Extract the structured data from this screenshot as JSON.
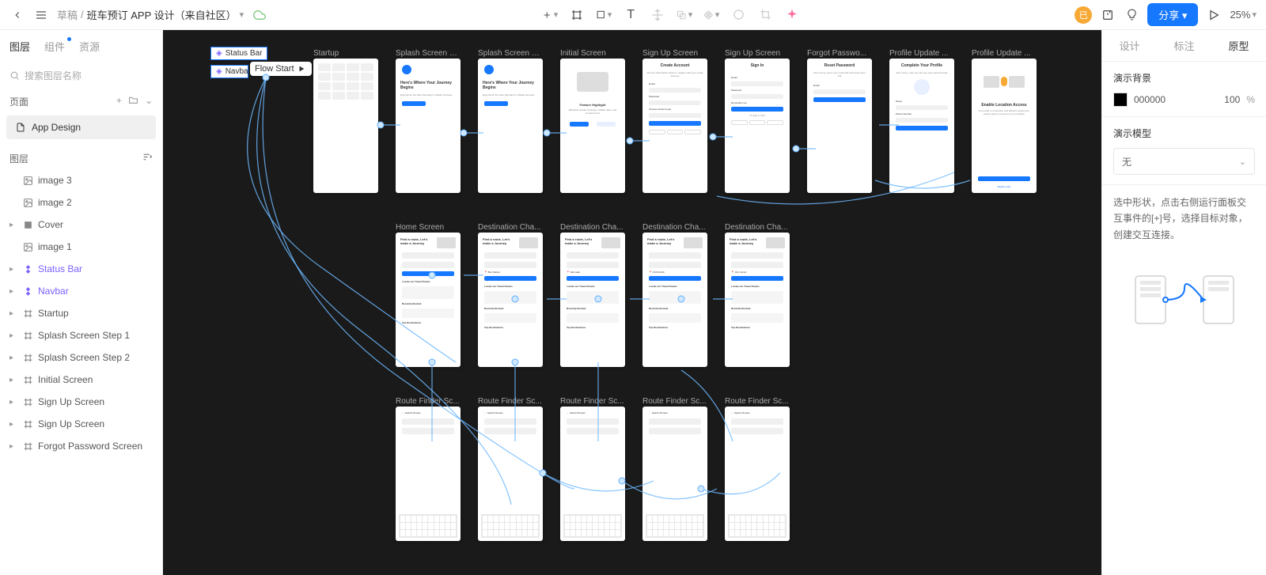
{
  "topbar": {
    "breadcrumb_draft": "草稿",
    "breadcrumb_title": "班车预订 APP 设计（来自社区）",
    "share": "分享",
    "zoom": "25%"
  },
  "left": {
    "tabs": {
      "layers": "图层",
      "components": "组件",
      "assets": "资源"
    },
    "search_placeholder": "搜索图层名称",
    "pages_label": "页面",
    "page_name": "App Design",
    "section_label": "图层",
    "layers": [
      {
        "name": "image 3",
        "icon": "img"
      },
      {
        "name": "image 2",
        "icon": "img"
      },
      {
        "name": "Cover",
        "icon": "square",
        "caret": true
      },
      {
        "name": "image 1",
        "icon": "img"
      },
      {
        "name": "Status Bar",
        "icon": "comp",
        "purple": true,
        "caret": true
      },
      {
        "name": "Navbar",
        "icon": "comp",
        "purple": true,
        "caret": true
      },
      {
        "name": "Startup",
        "icon": "frame",
        "caret": true
      },
      {
        "name": "Splash Screen Step 1",
        "icon": "frame",
        "caret": true
      },
      {
        "name": "Splash Screen Step 2",
        "icon": "frame",
        "caret": true
      },
      {
        "name": "Initial Screen",
        "icon": "frame",
        "caret": true
      },
      {
        "name": "Sign Up Screen",
        "icon": "frame",
        "caret": true
      },
      {
        "name": "Sign Up Screen",
        "icon": "frame",
        "caret": true
      },
      {
        "name": "Forgot Password Screen",
        "icon": "frame",
        "caret": true
      }
    ]
  },
  "canvas": {
    "selected": [
      {
        "name": "Status Bar"
      },
      {
        "name": "Navba"
      }
    ],
    "flow_start": "Flow Start",
    "row1": [
      {
        "label": "Startup"
      },
      {
        "label": "Splash Screen S..."
      },
      {
        "label": "Splash Screen S..."
      },
      {
        "label": "Initial Screen"
      },
      {
        "label": "Sign Up Screen"
      },
      {
        "label": "Sign Up Screen"
      },
      {
        "label": "Forgot Passwo..."
      },
      {
        "label": "Profile Update ..."
      },
      {
        "label": "Profile Update ..."
      }
    ],
    "row2": [
      {
        "label": "Home Screen"
      },
      {
        "label": "Destination Cha..."
      },
      {
        "label": "Destination Cha..."
      },
      {
        "label": "Destination Cha..."
      },
      {
        "label": "Destination Cha..."
      }
    ],
    "row3": [
      {
        "label": "Route Finder Sc..."
      },
      {
        "label": "Route Finder Sc..."
      },
      {
        "label": "Route Finder Sc..."
      },
      {
        "label": "Route Finder Sc..."
      },
      {
        "label": "Route Finder Sc..."
      }
    ],
    "content": {
      "splash_title": "Here's Where Your Journey Begins",
      "splash_sub": "Experience the New Standard in Shuttle Services",
      "get_started": "Get Started",
      "feature": "Feature Highlight",
      "feature_sub": "Effortless shuttle bookings, reliable rides, and smooth travel",
      "signin": "Sign In",
      "signup": "Sign Up",
      "create": "Create Account",
      "create_sub": "Fill your information below or register with your social account",
      "reset": "Reset Password",
      "reset_sub": "Don't worry, enter your email and we'll send reset link",
      "complete": "Complete Your Profile",
      "complete_sub": "Don't worry, only you can see your personal data",
      "enable_loc": "Enable Location Access",
      "enable_loc_sub": "To provide a convenient and efficient experience, please grant us access to your location",
      "allow": "Allow Location Access",
      "maybe": "Maybe Later",
      "email": "Email",
      "password": "Password",
      "name": "Name",
      "phone": "Phone Number",
      "enter_email": "Enter your email",
      "enter_pw": "Enter your password",
      "enter_name": "Enter your name",
      "enter_phone": "Enter phone number",
      "acct_type": "Choose account type",
      "remember": "Remember me",
      "agree": "I agree to the",
      "terms": "Terms & Condition & Privacy Policy",
      "submit": "Submit",
      "or": "Or sign in with",
      "home_h": "Find a route, Let's make a Journey",
      "from": "From",
      "to": "To",
      "search_shuttle": "Search Shuttle",
      "search_routes": "Search Routes",
      "locate": "Locate our Travel Routes",
      "recent": "Recently Booked",
      "topdest": "Top Destinations",
      "bus_station": "Bus Station",
      "salt_lake": "Salt Lake",
      "orchid": "Orchid Hub",
      "city_center": "City Center",
      "complete_profile_btn": "Complete Profile"
    }
  },
  "right": {
    "tabs": {
      "design": "设计",
      "annotate": "标注",
      "proto": "原型"
    },
    "bg_label": "演示背景",
    "bg_value": "000000",
    "bg_opacity": "100",
    "pct": "%",
    "model_label": "演示模型",
    "model_value": "无",
    "help": "选中形状，点击右侧运行面板交互事件的[+]号，选择目标对象，创建交互连接。"
  }
}
